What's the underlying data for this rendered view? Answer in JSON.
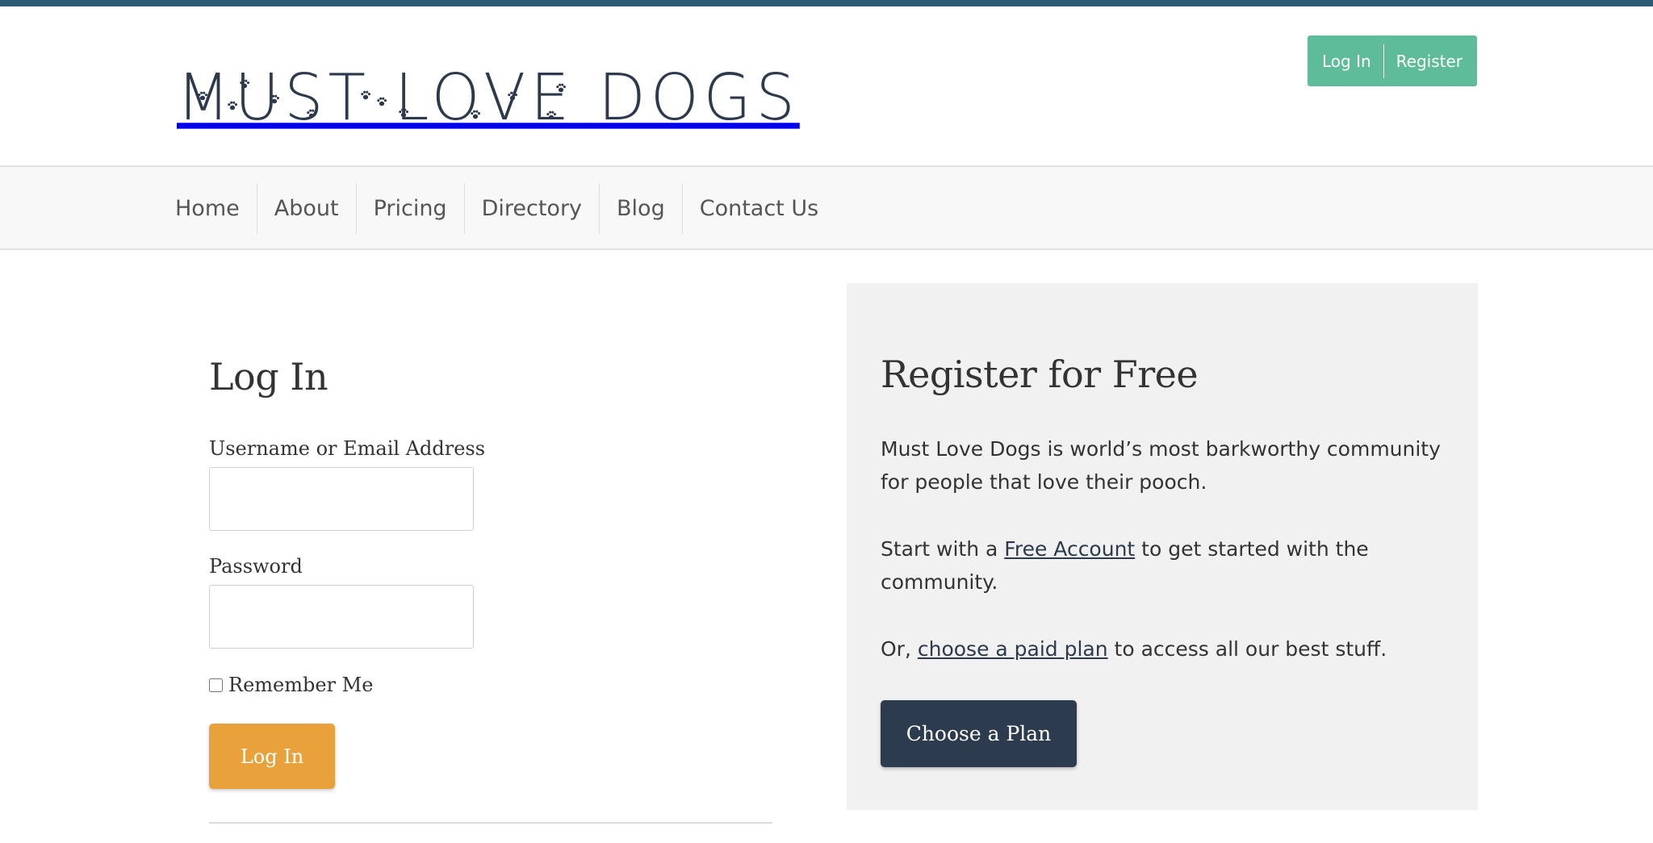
{
  "site": {
    "logo_text": "MUST LOVE DOGS"
  },
  "account": {
    "login_label": "Log In",
    "register_label": "Register"
  },
  "nav": {
    "items": [
      "Home",
      "About",
      "Pricing",
      "Directory",
      "Blog",
      "Contact Us"
    ]
  },
  "login": {
    "title": "Log In",
    "username_label": "Username or Email Address",
    "username_value": "",
    "password_label": "Password",
    "password_value": "",
    "remember_label": "Remember Me",
    "remember_checked": false,
    "submit_label": "Log In"
  },
  "register": {
    "title": "Register for Free",
    "intro": "Must Love Dogs is world’s most barkworthy community for people that love their pooch.",
    "start_prefix": "Start with a ",
    "start_link": "Free Account",
    "start_suffix": " to get started with the community.",
    "or_prefix": "Or, ",
    "or_link": "choose a paid plan",
    "or_suffix": " to access all our best stuff.",
    "button_label": "Choose a Plan"
  },
  "colors": {
    "top_strip": "#2b5a73",
    "account_box": "#5ebc9a",
    "login_button": "#e9a23b",
    "plan_button": "#2d3b4f",
    "logo": "#2d3a4d",
    "register_panel": "#f1f1f1"
  },
  "icons": [
    "paw-print-icon"
  ]
}
